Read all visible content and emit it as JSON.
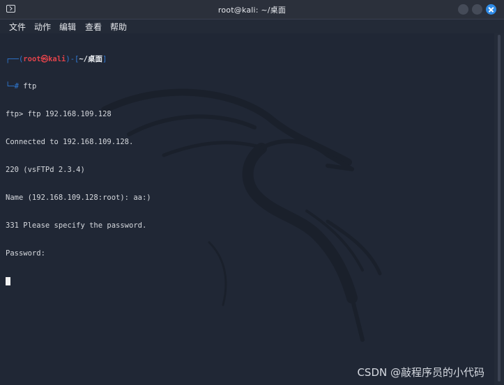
{
  "window": {
    "title": "root@kali: ~/桌面"
  },
  "menu": {
    "items": [
      "文件",
      "动作",
      "编辑",
      "查看",
      "帮助"
    ]
  },
  "terminal": {
    "prompt": {
      "bracket_open": "┌──(",
      "user": "root㉿kali",
      "mid": ")-[",
      "path": "~/桌面",
      "bracket_close": "]",
      "hash": "└─# ",
      "command": "ftp"
    },
    "lines": [
      "ftp> ftp 192.168.109.128",
      "Connected to 192.168.109.128.",
      "220 (vsFTPd 2.3.4)",
      "Name (192.168.109.128:root): aa:)",
      "331 Please specify the password.",
      "Password:"
    ]
  },
  "watermark": "CSDN @敲程序员的小代码",
  "colors": {
    "accent": "#2f7bd8",
    "prompt_user": "#e0434b",
    "background": "#202735"
  },
  "icons": [
    "terminal-icon",
    "minimize-icon",
    "maximize-icon",
    "close-icon",
    "kali-dragon-icon"
  ]
}
